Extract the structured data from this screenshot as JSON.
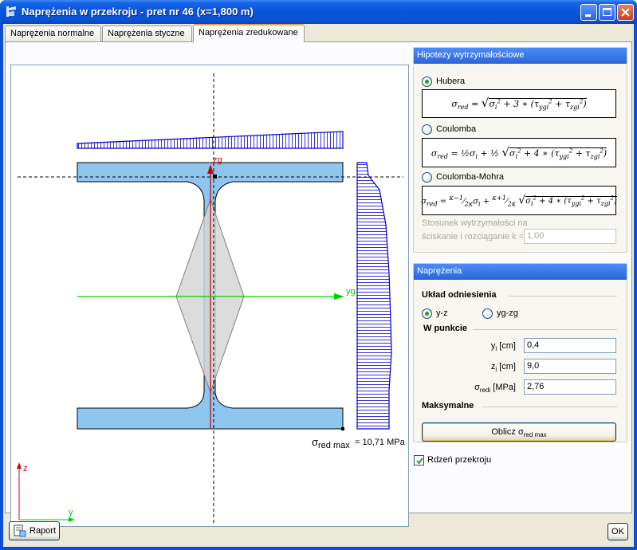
{
  "window": {
    "title": "Naprężenia w przekroju - pret nr 46 (x=1,800 m)",
    "icon": "stress-app-icon"
  },
  "tabs": [
    {
      "label": "Naprężenia normalne",
      "active": false
    },
    {
      "label": "Naprężenia styczne",
      "active": false
    },
    {
      "label": "Naprężenia zredukowane",
      "active": true
    }
  ],
  "canvas": {
    "axis_zg": "zg",
    "axis_yg": "yg",
    "axis_z": "z",
    "axis_y": "y",
    "max_label_prefix": "σ",
    "max_label_sub": "red max",
    "max_label_value": "= 10,71 MPa"
  },
  "hypotheses": {
    "title": "Hipotezy wytrzymałościowe",
    "options": [
      {
        "label": "Hubera",
        "checked": true
      },
      {
        "label": "Coulomba",
        "checked": false
      },
      {
        "label": "Coulomba-Mohra",
        "checked": false
      }
    ],
    "ratio_label_1": "Stosunek wytrzymałości na",
    "ratio_label_2": "ściskanie i rozciąganie k =",
    "ratio_value": "1,00"
  },
  "stresses": {
    "title": "Naprężenia",
    "reference_title": "Układ odniesienia",
    "reference_options": [
      {
        "label": "y-z",
        "checked": true
      },
      {
        "label": "yg-zg",
        "checked": false
      }
    ],
    "point_title": "W punkcie",
    "fields": [
      {
        "label_main": "y",
        "label_sub": "i",
        "label_unit": " [cm]",
        "value": "0,4"
      },
      {
        "label_main": "z",
        "label_sub": "i",
        "label_unit": " [cm]",
        "value": "9,0"
      },
      {
        "label_main": "σ",
        "label_sub": "redi",
        "label_unit": " [MPa]",
        "value": "2,76"
      }
    ],
    "max_title": "Maksymalne",
    "compute_label": "Oblicz σ",
    "compute_sub": "red max"
  },
  "core": {
    "label": "Rdzeń przekroju",
    "checked": true
  },
  "footer": {
    "report_label": "Raport",
    "ok_label": "OK"
  },
  "colors": {
    "titlebar": "#0a51d4",
    "flange_fill": "#8ec6ef",
    "diagram_blue": "#0000cc",
    "axis_red": "#cc0000",
    "axis_green": "#00cc00"
  }
}
